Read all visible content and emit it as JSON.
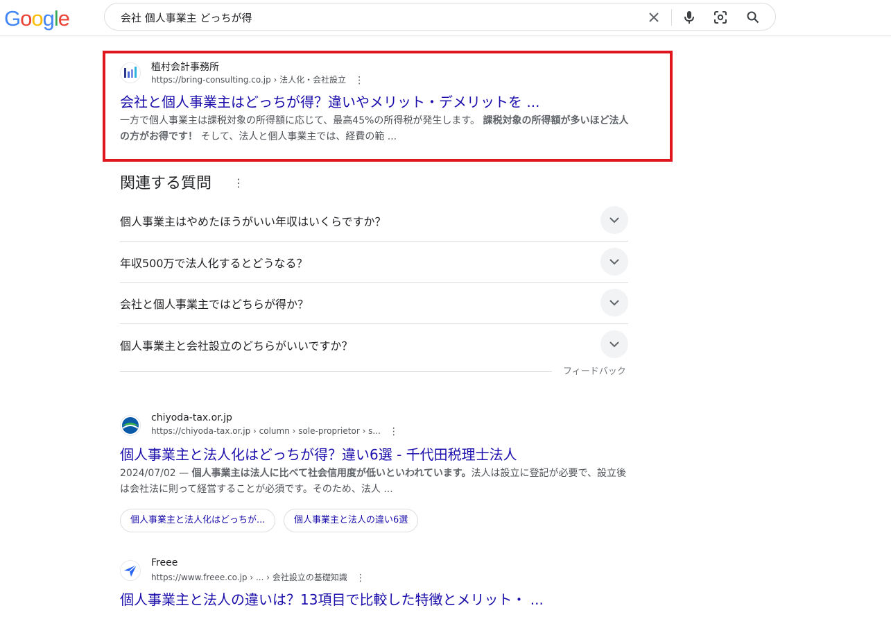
{
  "logo": {
    "letters": [
      "G",
      "o",
      "o",
      "g",
      "l",
      "e"
    ],
    "colors": [
      "#4285f4",
      "#ea4335",
      "#fbbc05",
      "#4285f4",
      "#34a853",
      "#ea4335"
    ]
  },
  "search": {
    "query": "会社 個人事業主 どっちが得"
  },
  "icons": {
    "clear": "close-icon",
    "voice": "mic-icon",
    "lens": "lens-icon",
    "search": "search-icon"
  },
  "results": [
    {
      "site_name": "植村会計事務所",
      "url": "https://bring-consulting.co.jp › 法人化・会社設立",
      "title": "会社と個人事業主はどっちが得？違いやメリット・デメリットを ...",
      "snippet_plain_1": "一方で個人事業主は課税対象の所得額に応じて、最高45%の所得税が発生します。 ",
      "snippet_bold_1": "課税対象の所得額が多いほど法人の方がお得です！",
      "snippet_plain_2": " そして、法人と個人事業主では、経費の範 ..."
    },
    {
      "site_name": "chiyoda-tax.or.jp",
      "url": "https://chiyoda-tax.or.jp › column › sole-proprietor › s...",
      "title": "個人事業主と法人化はどっちが得？違い6選 - 千代田税理士法人",
      "snippet_date": "2024/07/02 — ",
      "snippet_bold_1": "個人事業主は法人に比べて社会信用度が低いといわれています。",
      "snippet_plain_1": "法人は設立に登記が必要で、設立後は会社法に則って経営することが必須です。そのため、法人 ...",
      "chips": [
        "個人事業主と法人化はどっちが...",
        "個人事業主と法人の違い6選"
      ]
    },
    {
      "site_name": "Freee",
      "url": "https://www.freee.co.jp › ... › 会社設立の基礎知識",
      "title": "個人事業主と法人の違いは？13項目で比較した特徴とメリット・ ..."
    }
  ],
  "paa": {
    "heading": "関連する質問",
    "questions": [
      "個人事業主はやめたほうがいい年収はいくらですか？",
      "年収500万で法人化するとどうなる？",
      "会社と個人事業主ではどちらが得か？",
      "個人事業主と会社設立のどちらがいいですか？"
    ],
    "feedback": "フィードバック"
  },
  "highlight_color": "#e0161f"
}
